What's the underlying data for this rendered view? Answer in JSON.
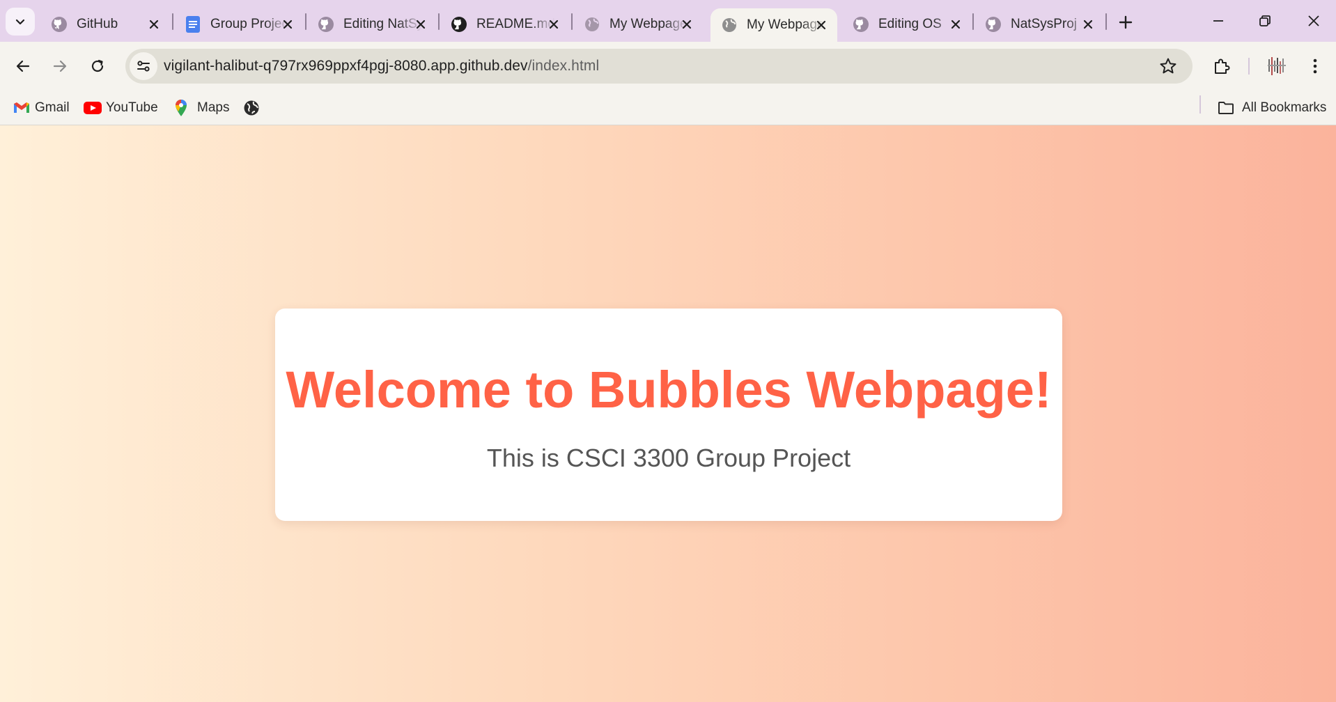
{
  "colors": {
    "tab_strip": "#e6d4ec",
    "toolbar": "#f5f3ee",
    "heading": "#ff6246",
    "subtitle": "#555555",
    "page_gradient_start": "#fff0d9",
    "page_gradient_end": "#fbb39c"
  },
  "tabs": [
    {
      "title": "GitHub",
      "icon": "github-icon",
      "active": false
    },
    {
      "title": "Group Project",
      "icon": "google-docs-icon",
      "active": false
    },
    {
      "title": "Editing NatSysProj",
      "icon": "github-icon",
      "active": false
    },
    {
      "title": "README.md",
      "icon": "github-icon",
      "active": false
    },
    {
      "title": "My Webpage",
      "icon": "globe-icon",
      "active": false
    },
    {
      "title": "My Webpage",
      "icon": "globe-icon",
      "active": true
    },
    {
      "title": "Editing OS",
      "icon": "github-icon",
      "active": false
    },
    {
      "title": "NatSysProj",
      "icon": "github-icon",
      "active": false
    }
  ],
  "address_bar": {
    "host": "vigilant-halibut-q797rx969ppxf4pgj-8080.app.github.dev",
    "path": "/index.html"
  },
  "bookmarks": {
    "items": [
      {
        "label": "Gmail",
        "icon": "gmail-icon"
      },
      {
        "label": "YouTube",
        "icon": "youtube-icon"
      },
      {
        "label": "Maps",
        "icon": "maps-icon"
      },
      {
        "label": "",
        "icon": "globe-icon"
      }
    ],
    "all_bookmarks_label": "All Bookmarks"
  },
  "page": {
    "heading": "Welcome to Bubbles Webpage!",
    "subtitle": "This is CSCI 3300 Group Project"
  }
}
